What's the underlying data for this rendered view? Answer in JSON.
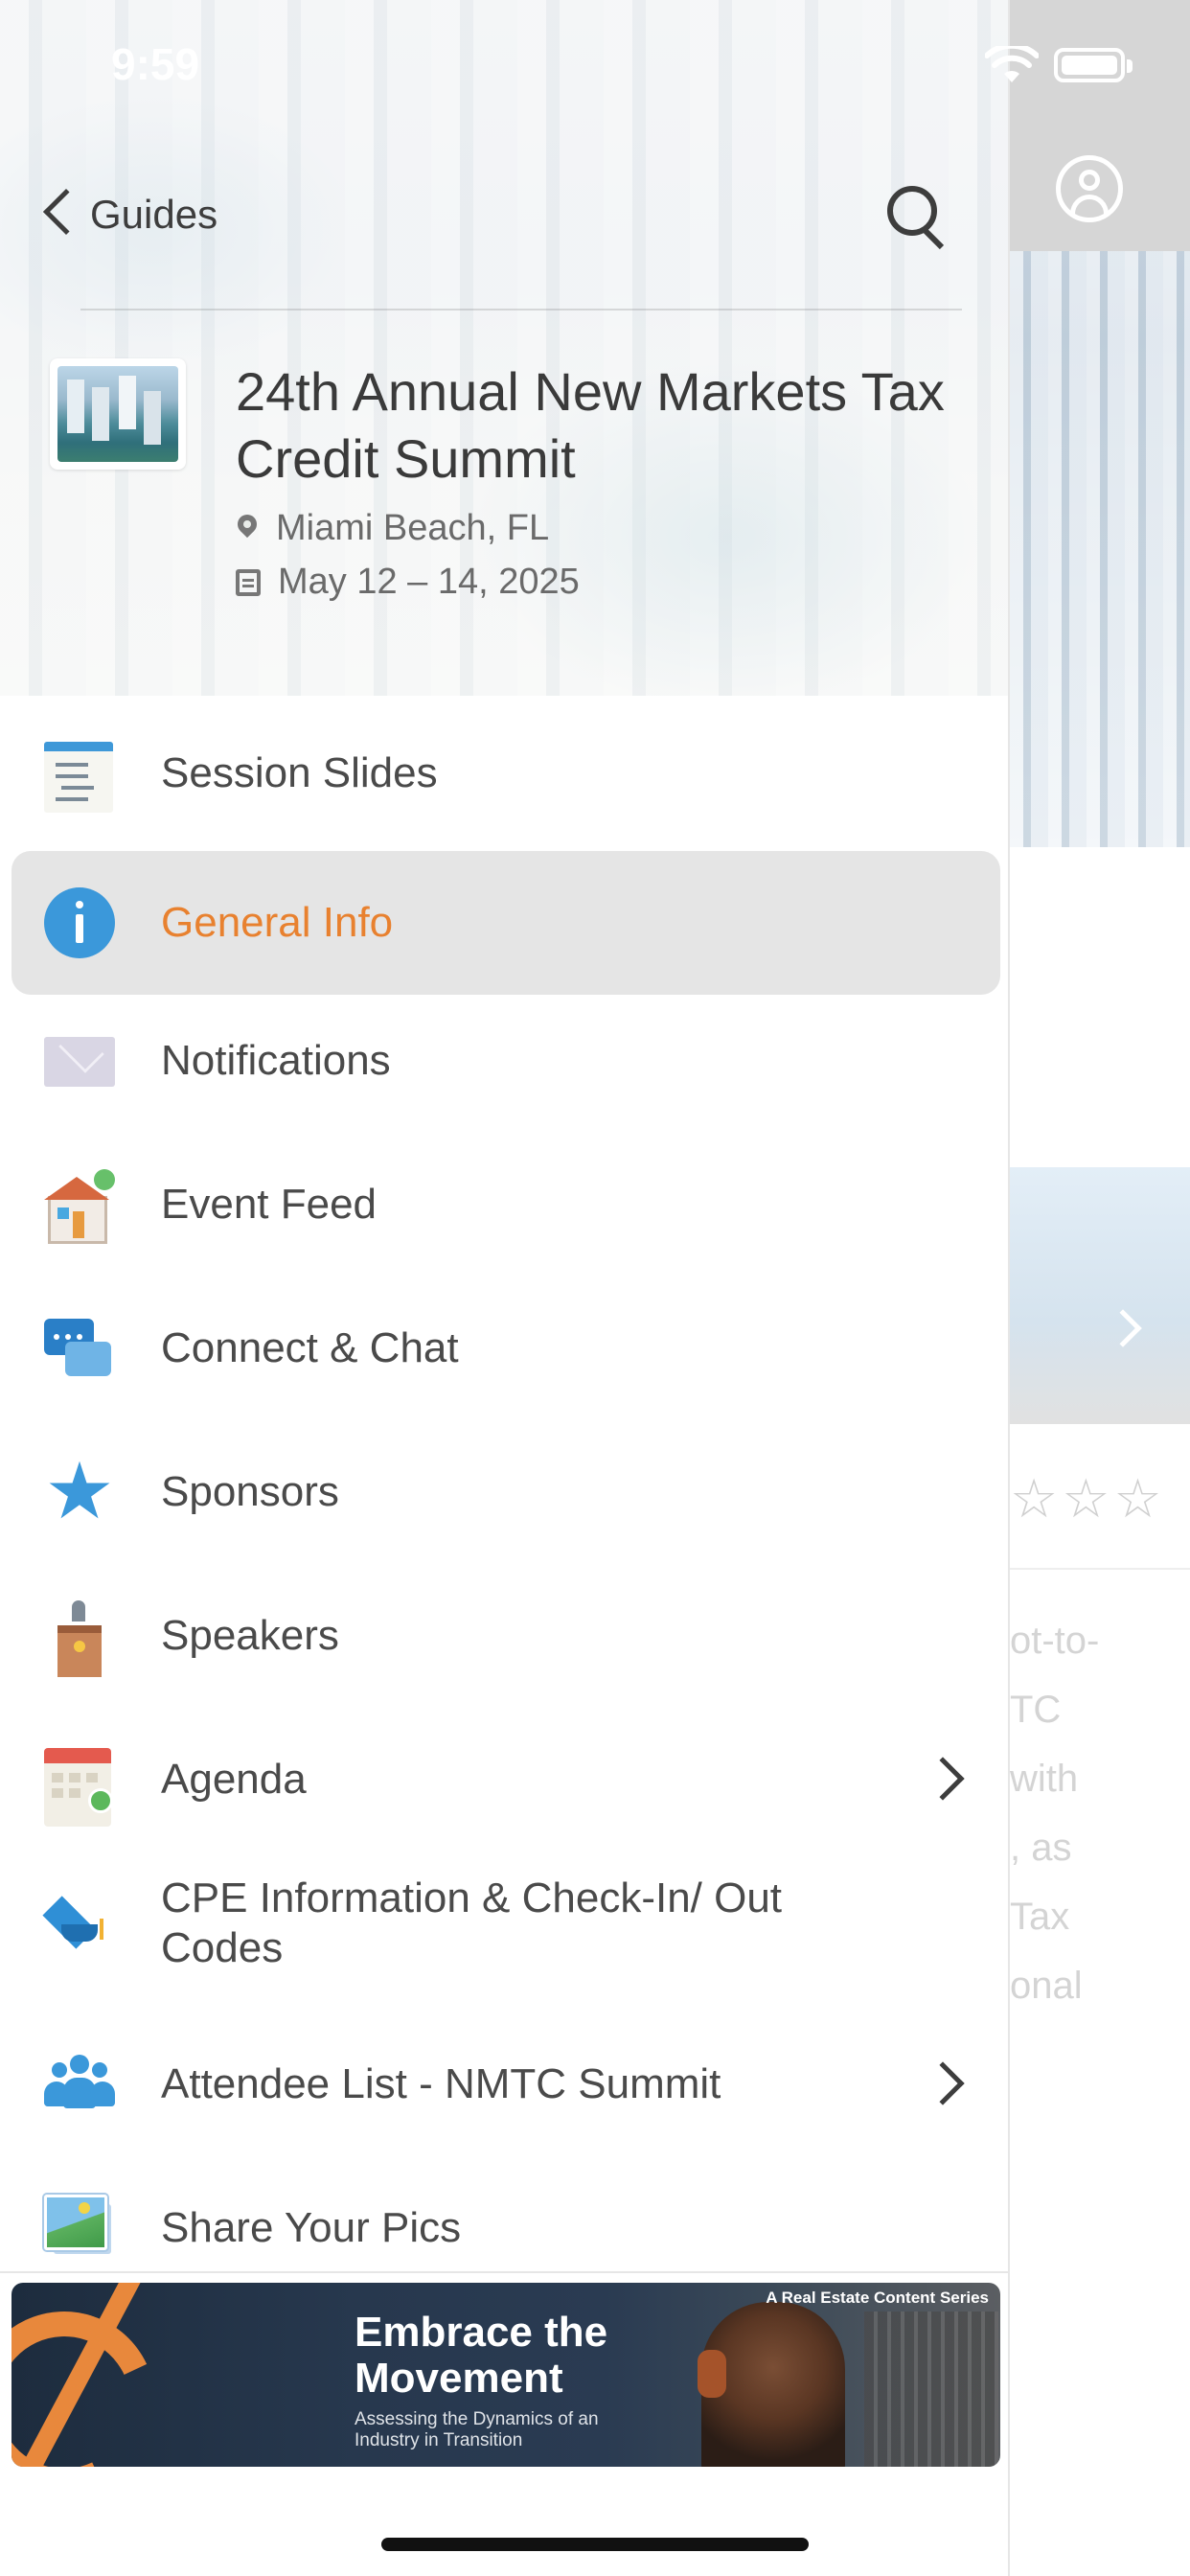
{
  "status_bar": {
    "time": "9:59"
  },
  "header": {
    "back_label": "Guides",
    "event_title": "24th Annual New Markets Tax Credit Summit",
    "location": "Miami Beach, FL",
    "dates": "May 12 – 14, 2025"
  },
  "menu": {
    "items": [
      {
        "label": "Session Slides",
        "icon": "slides-icon"
      },
      {
        "label": "General Info",
        "icon": "info-icon",
        "active": true
      },
      {
        "label": "Notifications",
        "icon": "envelope-icon"
      },
      {
        "label": "Event Feed",
        "icon": "house-icon"
      },
      {
        "label": "Connect & Chat",
        "icon": "chat-bubbles-icon"
      },
      {
        "label": "Sponsors",
        "icon": "star-icon"
      },
      {
        "label": "Speakers",
        "icon": "podium-icon"
      },
      {
        "label": "Agenda",
        "icon": "calendar-icon",
        "has_chevron": true
      },
      {
        "label": "CPE Information & Check-In/ Out Codes",
        "icon": "graduation-cap-icon"
      },
      {
        "label": "Attendee List - NMTC Summit",
        "icon": "people-icon",
        "has_chevron": true
      },
      {
        "label": "Share Your Pics",
        "icon": "photos-icon"
      }
    ],
    "active_color": "#e8812f"
  },
  "ad": {
    "title": "Embrace the Movement",
    "subtitle": "Assessing the Dynamics of an Industry in Transition",
    "series": "A Real Estate Content Series"
  },
  "background_page": {
    "text_fragments": [
      "ot-to-",
      "TC",
      "with",
      ", as",
      "Tax",
      "onal"
    ]
  },
  "colors": {
    "accent_blue": "#3b98da",
    "active_bg": "#e5e5e5"
  }
}
